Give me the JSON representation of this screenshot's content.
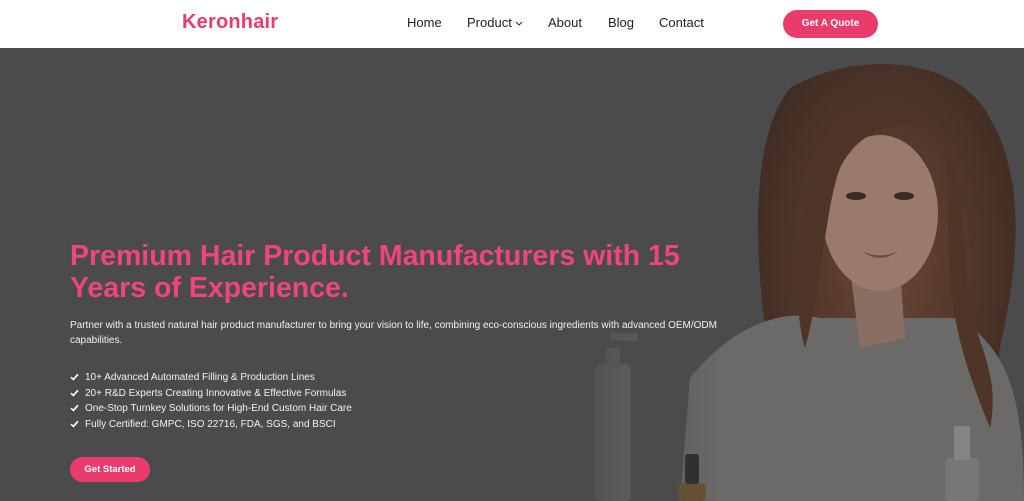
{
  "header": {
    "logo": "Keronhair",
    "nav": {
      "home": "Home",
      "product": "Product",
      "about": "About",
      "blog": "Blog",
      "contact": "Contact"
    },
    "cta_label": "Get A Quote"
  },
  "hero": {
    "headline_line1": "Premium Hair Product Manufacturers with 15",
    "headline_line2": "Years of Experience.",
    "intro": "Partner with a trusted natural hair product manufacturer to bring your vision to life, combining eco-conscious ingredients with advanced OEM/ODM capabilities.",
    "features": [
      "10+ Advanced Automated Filling & Production Lines",
      "20+ R&D Experts Creating Innovative & Effective Formulas",
      "One-Stop Turnkey Solutions for High-End Custom Hair Care",
      "Fully Certified: GMPC, ISO 22716, FDA, SGS, and BSCI"
    ],
    "cta_label": "Get Started"
  },
  "icons": {
    "nav_dropdown": "chevron-down-icon",
    "feature_bullet": "check-icon"
  },
  "colors": {
    "brand_pink": "#ea3c6c",
    "headline_pink": "#ee4679",
    "hero_overlay": "#4b4b4d",
    "header_bg": "#ffffff",
    "nav_text": "#222222"
  }
}
